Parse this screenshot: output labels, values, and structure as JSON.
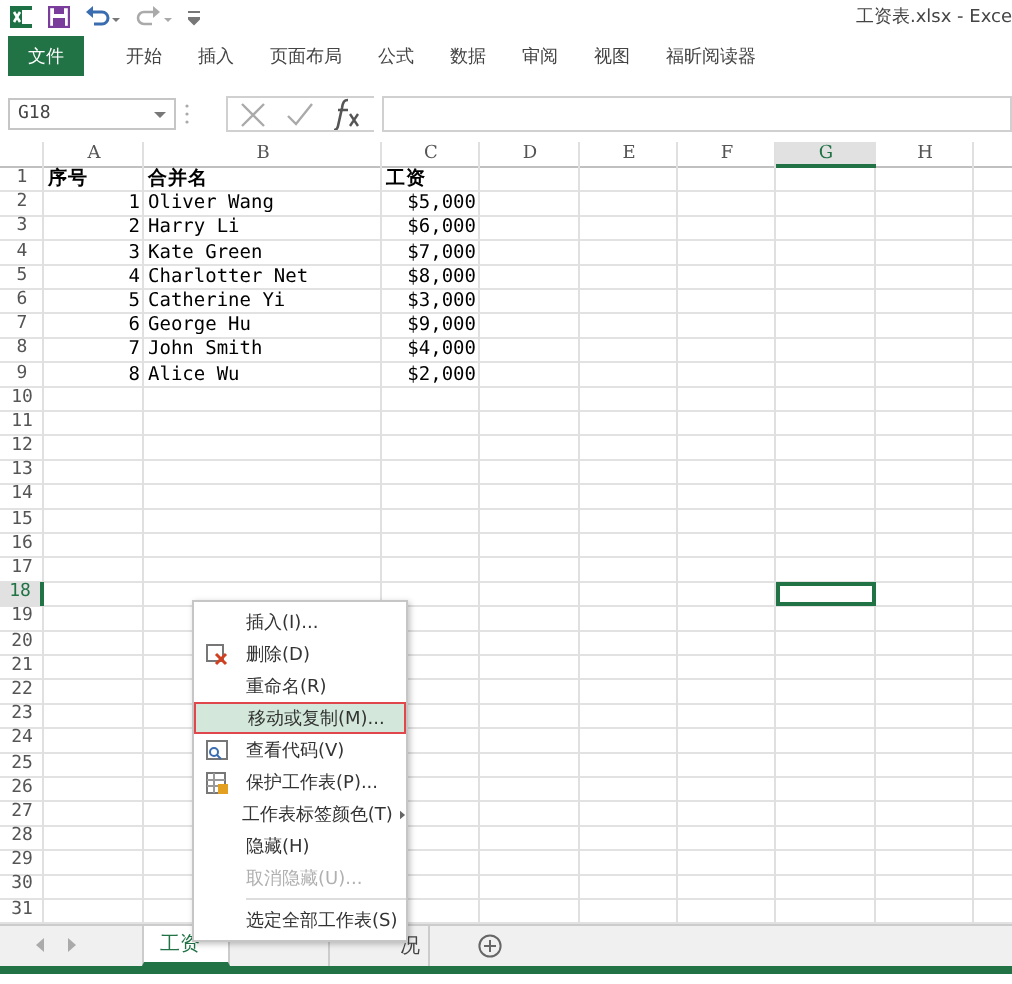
{
  "title_bar": {
    "title": "工资表.xlsx - Exce"
  },
  "ribbon_tabs": [
    {
      "label": "文件",
      "kind": "file"
    },
    {
      "label": "开始",
      "kind": "tab"
    },
    {
      "label": "插入",
      "kind": "tab"
    },
    {
      "label": "页面布局",
      "kind": "tab"
    },
    {
      "label": "公式",
      "kind": "tab"
    },
    {
      "label": "数据",
      "kind": "tab"
    },
    {
      "label": "审阅",
      "kind": "tab"
    },
    {
      "label": "视图",
      "kind": "tab"
    },
    {
      "label": "福昕阅读器",
      "kind": "tab"
    }
  ],
  "formula_bar": {
    "name_box": "G18"
  },
  "sheet": {
    "columns": [
      {
        "label": "A",
        "selected": false
      },
      {
        "label": "B",
        "selected": false
      },
      {
        "label": "C",
        "selected": false
      },
      {
        "label": "D",
        "selected": false
      },
      {
        "label": "E",
        "selected": false
      },
      {
        "label": "F",
        "selected": false
      },
      {
        "label": "G",
        "selected": true
      },
      {
        "label": "H",
        "selected": false
      }
    ],
    "rows": [
      {
        "header": "1",
        "selected": false,
        "kind": "heading",
        "cells": [
          "序号",
          "合并名",
          "工资"
        ]
      },
      {
        "header": "2",
        "selected": false,
        "kind": "data",
        "cells": [
          "1",
          "Oliver Wang",
          "$5,000"
        ]
      },
      {
        "header": "3",
        "selected": false,
        "kind": "data",
        "cells": [
          "2",
          "Harry Li",
          "$6,000"
        ]
      },
      {
        "header": "4",
        "selected": false,
        "kind": "data",
        "cells": [
          "3",
          "Kate Green",
          "$7,000"
        ]
      },
      {
        "header": "5",
        "selected": false,
        "kind": "data",
        "cells": [
          "4",
          "Charlotter Net",
          "$8,000"
        ]
      },
      {
        "header": "6",
        "selected": false,
        "kind": "data",
        "cells": [
          "5",
          "Catherine Yi",
          "$3,000"
        ]
      },
      {
        "header": "7",
        "selected": false,
        "kind": "data",
        "cells": [
          "6",
          "George Hu",
          "$9,000"
        ]
      },
      {
        "header": "8",
        "selected": false,
        "kind": "data",
        "cells": [
          "7",
          "John Smith",
          "$4,000"
        ]
      },
      {
        "header": "9",
        "selected": false,
        "kind": "data",
        "cells": [
          "8",
          "Alice Wu",
          "$2,000"
        ]
      },
      {
        "header": "10",
        "selected": false
      },
      {
        "header": "11",
        "selected": false
      },
      {
        "header": "12",
        "selected": false
      },
      {
        "header": "13",
        "selected": false
      },
      {
        "header": "14",
        "selected": false
      },
      {
        "header": "15",
        "selected": false
      },
      {
        "header": "16",
        "selected": false
      },
      {
        "header": "17",
        "selected": false
      },
      {
        "header": "18",
        "selected": true
      },
      {
        "header": "19",
        "selected": false
      },
      {
        "header": "20",
        "selected": false
      },
      {
        "header": "21",
        "selected": false
      },
      {
        "header": "22",
        "selected": false
      },
      {
        "header": "23",
        "selected": false
      },
      {
        "header": "24",
        "selected": false
      },
      {
        "header": "25",
        "selected": false
      },
      {
        "header": "26",
        "selected": false
      },
      {
        "header": "27",
        "selected": false
      },
      {
        "header": "28",
        "selected": false
      },
      {
        "header": "29",
        "selected": false
      },
      {
        "header": "30",
        "selected": false
      },
      {
        "header": "31",
        "selected": false
      }
    ]
  },
  "sheet_tabs": [
    {
      "label": "工资",
      "selected": true
    },
    {
      "selected": false
    },
    {
      "label": "况",
      "selected": false
    }
  ],
  "context_menu": [
    {
      "label": "插入(I)...",
      "kind": "plain",
      "highlighted": false,
      "disabled": false
    },
    {
      "label": "删除(D)",
      "kind": "delete",
      "highlighted": false,
      "disabled": false
    },
    {
      "label": "重命名(R)",
      "kind": "plain",
      "highlighted": false,
      "disabled": false
    },
    {
      "label": "移动或复制(M)...",
      "kind": "plain",
      "highlighted": true,
      "disabled": false
    },
    {
      "label": "查看代码(V)",
      "kind": "code",
      "highlighted": false,
      "disabled": false
    },
    {
      "label": "保护工作表(P)...",
      "kind": "protect",
      "highlighted": false,
      "disabled": false
    },
    {
      "label": "工作表标签颜色(T)",
      "kind": "submenu",
      "highlighted": false,
      "disabled": false
    },
    {
      "label": "隐藏(H)",
      "kind": "plain",
      "highlighted": false,
      "disabled": false
    },
    {
      "label": "取消隐藏(U)...",
      "kind": "plain",
      "highlighted": false,
      "disabled": true
    },
    {
      "kind": "separator"
    },
    {
      "label": "选定全部工作表(S)",
      "kind": "plain",
      "highlighted": false,
      "disabled": false
    }
  ]
}
